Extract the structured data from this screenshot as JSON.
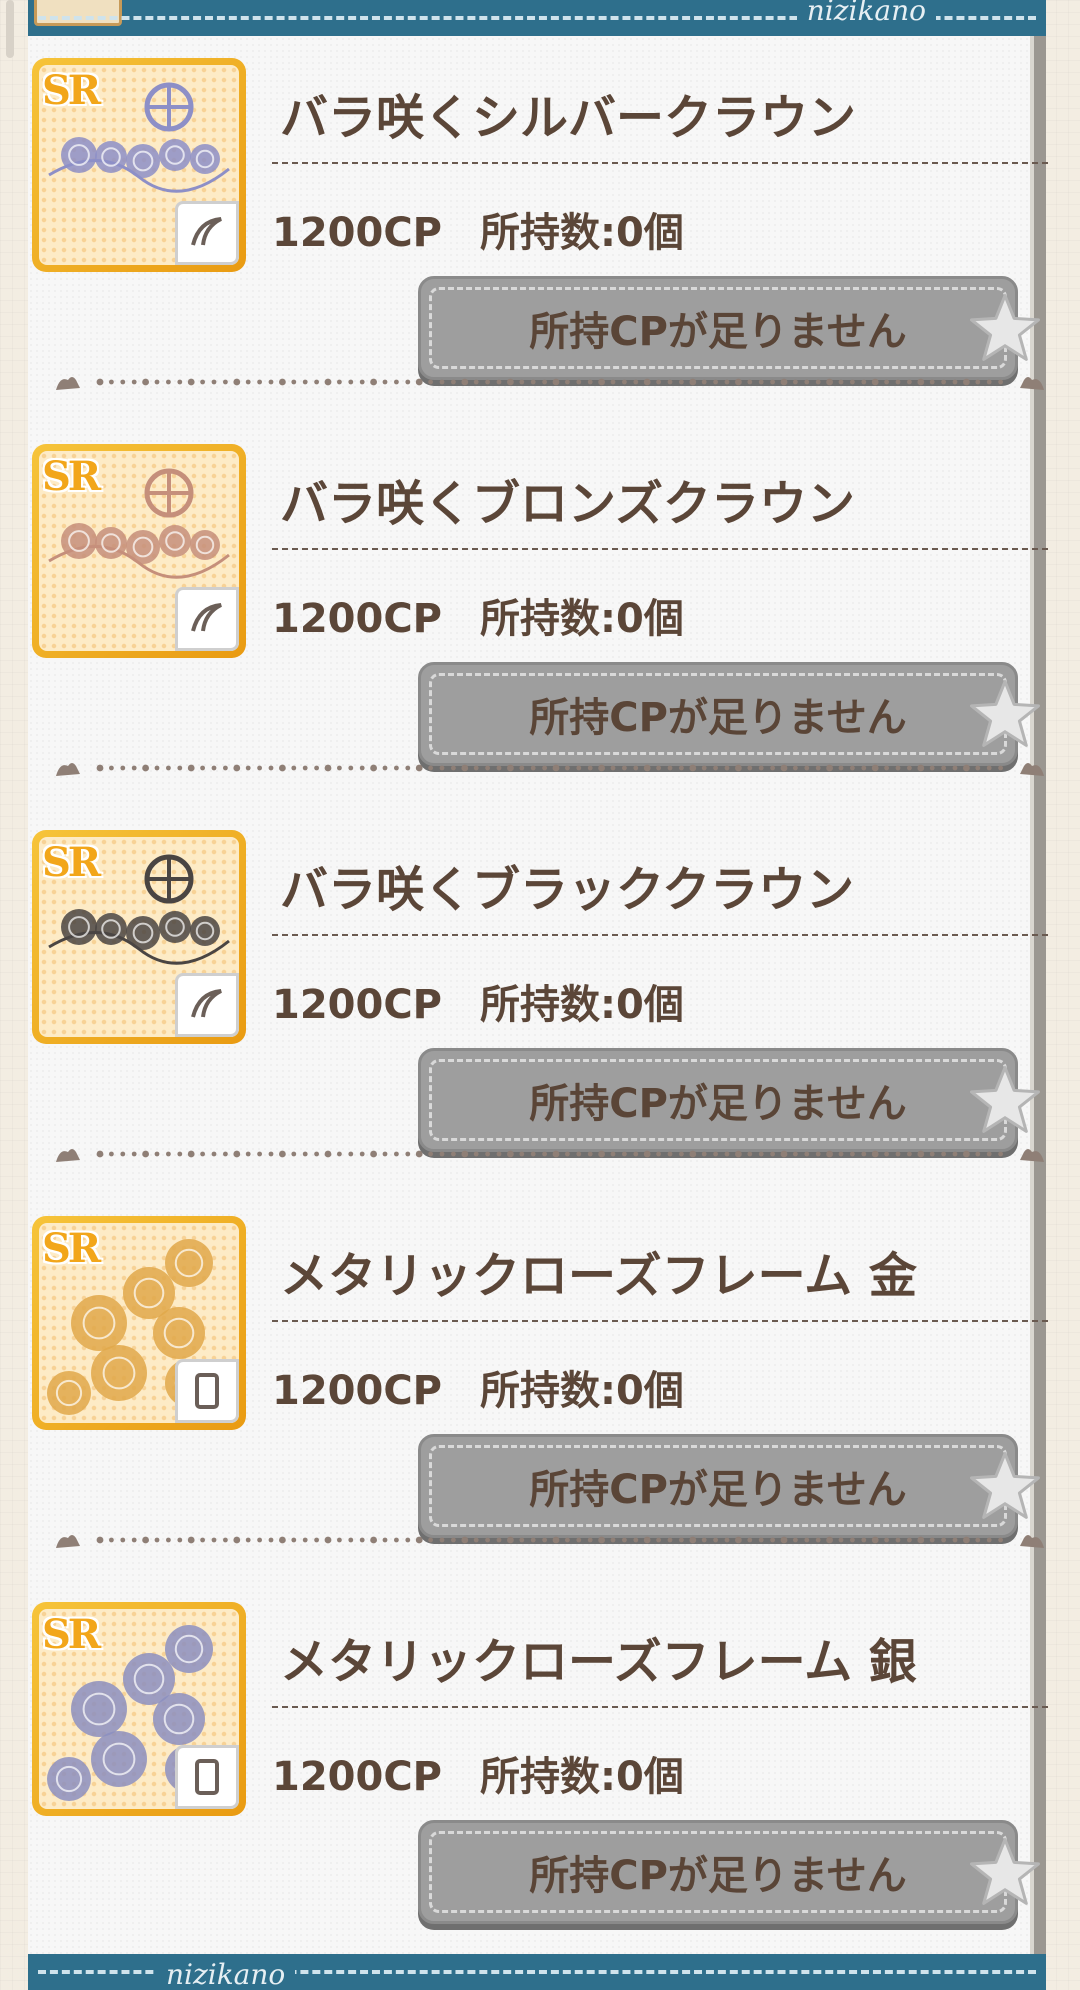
{
  "header": {
    "brand": "nizikano"
  },
  "footer": {
    "brand": "nizikano"
  },
  "items": [
    {
      "title": "バラ咲くシルバークラウン",
      "price": "1200CP",
      "owned": "所持数:0個",
      "button": "所持CPが足りません",
      "rarity": "SR",
      "icon": "crown-icon",
      "tint": "#8d8fc7"
    },
    {
      "title": "バラ咲くブロンズクラウン",
      "price": "1200CP",
      "owned": "所持数:0個",
      "button": "所持CPが足りません",
      "rarity": "SR",
      "icon": "crown-icon",
      "tint": "#c58f7b"
    },
    {
      "title": "バラ咲くブラッククラウン",
      "price": "1200CP",
      "owned": "所持数:0個",
      "button": "所持CPが足りません",
      "rarity": "SR",
      "icon": "crown-icon",
      "tint": "#4a4543"
    },
    {
      "title": "メタリックローズフレーム 金",
      "price": "1200CP",
      "owned": "所持数:0個",
      "button": "所持CPが足りません",
      "rarity": "SR",
      "icon": "frame-icon",
      "tint": "#e0a84a"
    },
    {
      "title": "メタリックローズフレーム 銀",
      "price": "1200CP",
      "owned": "所持数:0個",
      "button": "所持CPが足りません",
      "rarity": "SR",
      "icon": "frame-icon",
      "tint": "#8c8fc0"
    }
  ]
}
